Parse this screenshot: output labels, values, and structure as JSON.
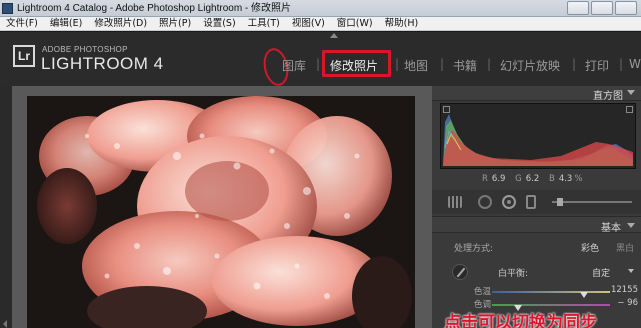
{
  "window": {
    "title": "Lightroom 4 Catalog - Adobe Photoshop Lightroom - 修改照片"
  },
  "menu": {
    "items": [
      {
        "label": "文件(F)"
      },
      {
        "label": "编辑(E)"
      },
      {
        "label": "修改照片(D)"
      },
      {
        "label": "照片(P)"
      },
      {
        "label": "设置(S)"
      },
      {
        "label": "工具(T)"
      },
      {
        "label": "视图(V)"
      },
      {
        "label": "窗口(W)"
      },
      {
        "label": "帮助(H)"
      }
    ]
  },
  "brand": {
    "badge": "Lr",
    "small": "ADOBE PHOTOSHOP",
    "big": "LIGHTROOM 4"
  },
  "modules": {
    "library": "图库",
    "develop": "修改照片",
    "map": "地图",
    "book": "书籍",
    "slideshow": "幻灯片放映",
    "print": "打印",
    "web": "W",
    "separator": "|"
  },
  "histogram": {
    "title": "直方图",
    "exif": {
      "r_label": "R",
      "r_value": "6.9",
      "g_label": "G",
      "g_value": "6.2",
      "b_label": "B",
      "b_value": "4.3",
      "unit": "%"
    }
  },
  "basic": {
    "title": "基本",
    "treatment_label": "处理方式:",
    "treatment_color": "彩色",
    "treatment_bw": "黑白",
    "wb_label": "白平衡:",
    "wb_value": "自定",
    "temp_label": "色温",
    "temp_value": "12155",
    "temp_position": 0.78,
    "tint_label": "色调",
    "tint_value": "− 96",
    "tint_position": 0.22
  },
  "caption": "点击可以切换为同步",
  "colors": {
    "annotation_red": "#d6162b",
    "panel_bg": "#3a3a3a",
    "canvas_bg": "#595959"
  },
  "icons": {
    "eyedropper": "eyedropper-icon",
    "histogram_collapse": "triangle-down-icon",
    "basic_collapse": "triangle-down-icon",
    "module_arrow": "arrow-up-icon"
  }
}
